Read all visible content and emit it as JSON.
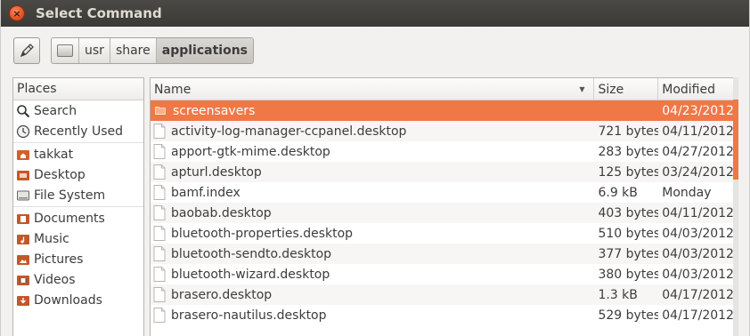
{
  "window": {
    "title": "Select Command"
  },
  "path_bar": {
    "segments": [
      {
        "label": "usr"
      },
      {
        "label": "share"
      },
      {
        "label": "applications"
      }
    ]
  },
  "places": {
    "header": "Places",
    "items": [
      {
        "label": "Search",
        "icon": "magnifier-icon"
      },
      {
        "label": "Recently Used",
        "icon": "clock-icon"
      },
      {
        "label": "takkat",
        "icon": "home-folder-icon"
      },
      {
        "label": "Desktop",
        "icon": "desktop-icon"
      },
      {
        "label": "File System",
        "icon": "drive-icon"
      },
      {
        "label": "Documents",
        "icon": "documents-folder-icon"
      },
      {
        "label": "Music",
        "icon": "music-folder-icon"
      },
      {
        "label": "Pictures",
        "icon": "pictures-folder-icon"
      },
      {
        "label": "Videos",
        "icon": "videos-folder-icon"
      },
      {
        "label": "Downloads",
        "icon": "downloads-folder-icon"
      }
    ]
  },
  "file_list": {
    "columns": {
      "name": "Name",
      "size": "Size",
      "modified": "Modified"
    },
    "rows": [
      {
        "name": "screensavers",
        "size": "",
        "modified": "04/23/2012",
        "type": "folder"
      },
      {
        "name": "activity-log-manager-ccpanel.desktop",
        "size": "721 bytes",
        "modified": "04/11/2012",
        "type": "file"
      },
      {
        "name": "apport-gtk-mime.desktop",
        "size": "283 bytes",
        "modified": "04/27/2012",
        "type": "file"
      },
      {
        "name": "apturl.desktop",
        "size": "125 bytes",
        "modified": "03/24/2012",
        "type": "file"
      },
      {
        "name": "bamf.index",
        "size": "6.9 kB",
        "modified": "Monday",
        "type": "file"
      },
      {
        "name": "baobab.desktop",
        "size": "403 bytes",
        "modified": "04/11/2012",
        "type": "file"
      },
      {
        "name": "bluetooth-properties.desktop",
        "size": "510 bytes",
        "modified": "04/03/2012",
        "type": "file"
      },
      {
        "name": "bluetooth-sendto.desktop",
        "size": "377 bytes",
        "modified": "04/03/2012",
        "type": "file"
      },
      {
        "name": "bluetooth-wizard.desktop",
        "size": "380 bytes",
        "modified": "04/03/2012",
        "type": "file"
      },
      {
        "name": "brasero.desktop",
        "size": "1.3 kB",
        "modified": "04/17/2012",
        "type": "file"
      },
      {
        "name": "brasero-nautilus.desktop",
        "size": "529 bytes",
        "modified": "04/17/2012",
        "type": "file"
      }
    ],
    "selected_index": 0
  },
  "colors": {
    "selection": "#f07746",
    "titlebar": "#3b3a36",
    "close_button": "#df4a16"
  }
}
